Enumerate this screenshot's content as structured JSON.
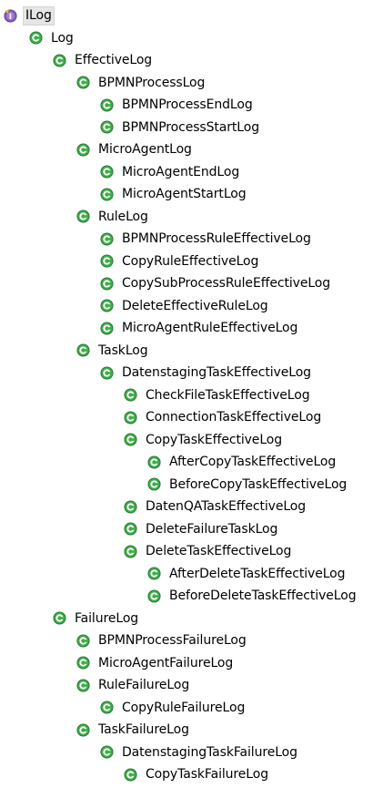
{
  "root": {
    "label": "ILog",
    "icon": "interface-icon"
  },
  "tree": [
    {
      "label": "Log",
      "depth": 1
    },
    {
      "label": "EffectiveLog",
      "depth": 2
    },
    {
      "label": "BPMNProcessLog",
      "depth": 3
    },
    {
      "label": "BPMNProcessEndLog",
      "depth": 4
    },
    {
      "label": "BPMNProcessStartLog",
      "depth": 4
    },
    {
      "label": "MicroAgentLog",
      "depth": 3
    },
    {
      "label": "MicroAgentEndLog",
      "depth": 4
    },
    {
      "label": "MicroAgentStartLog",
      "depth": 4
    },
    {
      "label": "RuleLog",
      "depth": 3
    },
    {
      "label": "BPMNProcessRuleEffectiveLog",
      "depth": 4
    },
    {
      "label": "CopyRuleEffectiveLog",
      "depth": 4
    },
    {
      "label": "CopySubProcessRuleEffectiveLog",
      "depth": 4
    },
    {
      "label": "DeleteEffectiveRuleLog",
      "depth": 4
    },
    {
      "label": "MicroAgentRuleEffectiveLog",
      "depth": 4
    },
    {
      "label": "TaskLog",
      "depth": 3
    },
    {
      "label": "DatenstagingTaskEffectiveLog",
      "depth": 4
    },
    {
      "label": "CheckFileTaskEffectiveLog",
      "depth": 5
    },
    {
      "label": "ConnectionTaskEffectiveLog",
      "depth": 5
    },
    {
      "label": "CopyTaskEffectiveLog",
      "depth": 5
    },
    {
      "label": "AfterCopyTaskEffectiveLog",
      "depth": 6
    },
    {
      "label": "BeforeCopyTaskEffectiveLog",
      "depth": 6
    },
    {
      "label": "DatenQATaskEffectiveLog",
      "depth": 5
    },
    {
      "label": "DeleteFailureTaskLog",
      "depth": 5
    },
    {
      "label": "DeleteTaskEffectiveLog",
      "depth": 5
    },
    {
      "label": "AfterDeleteTaskEffectiveLog",
      "depth": 6
    },
    {
      "label": "BeforeDeleteTaskEffectiveLog",
      "depth": 6
    },
    {
      "label": "FailureLog",
      "depth": 2
    },
    {
      "label": "BPMNProcessFailureLog",
      "depth": 3
    },
    {
      "label": "MicroAgentFailureLog",
      "depth": 3
    },
    {
      "label": "RuleFailureLog",
      "depth": 3
    },
    {
      "label": "CopyRuleFailureLog",
      "depth": 4
    },
    {
      "label": "TaskFailureLog",
      "depth": 3
    },
    {
      "label": "DatenstagingTaskFailureLog",
      "depth": 4
    },
    {
      "label": "CopyTaskFailureLog",
      "depth": 5
    }
  ],
  "colors": {
    "class_icon_fill": "#2e9a3a",
    "class_icon_ring": "#1d6e26",
    "interface_icon_fill": "#7b4bb3",
    "selection_bg": "#e6e6e6"
  }
}
